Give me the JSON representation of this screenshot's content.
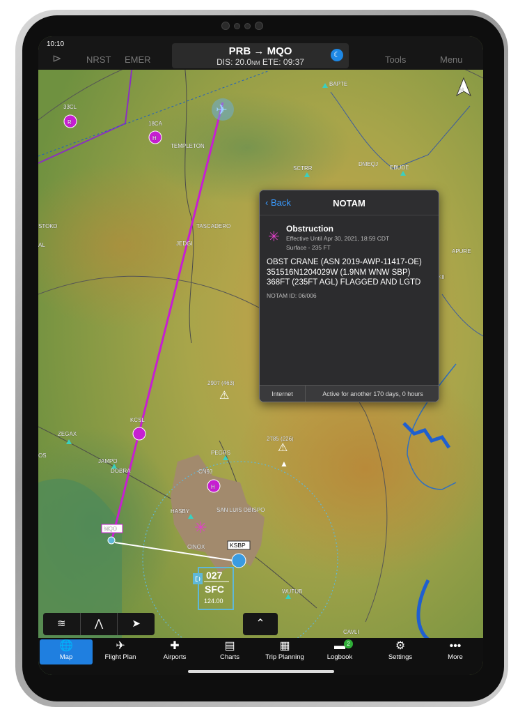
{
  "status_bar": {
    "time": "10:10"
  },
  "top_bar": {
    "direct_to": "⊳",
    "nrst": "NRST",
    "emer": "EMER",
    "route_title": "PRB → MQO",
    "route_sub_dis": "DIS: 20.0",
    "route_sub_unit": "NM",
    "route_sub_ete": "ETE: 09:37",
    "tools": "Tools",
    "menu": "Menu"
  },
  "map": {
    "north": "N",
    "waypoints": [
      "33CL",
      "18CA",
      "TEMPLETON",
      "BAPTE",
      "SCTRR",
      "DMEQJ",
      "EBUDE",
      "TASCADERO",
      "JEDGI",
      "STOKD",
      "AL",
      "APURE",
      "KII",
      "2907 (463)",
      "ZEGAX",
      "KCSL",
      "JAMPO",
      "DOBRA",
      "PEGRS",
      "CN93",
      "2785 (226)",
      "HASBY",
      "SAN LUIS OBISPO",
      "CINOX",
      "OS",
      "WUTUB",
      "CAVLI"
    ],
    "mqo_label": "MQO",
    "ksbp_label": "KSBP",
    "airspace": {
      "class": "D",
      "top": "027",
      "bottom": "SFC",
      "freq": "124.00"
    }
  },
  "notam": {
    "back": "Back",
    "title": "NOTAM",
    "type": "Obstruction",
    "effective": "Effective Until Apr 30, 2021, 18:59 CDT",
    "surface": "Surface - 235 FT",
    "text": "OBST CRANE (ASN 2019-AWP-11417-OE) 351516N1204029W (1.9NM WNW SBP) 368FT (235FT AGL) FLAGGED AND LGTD",
    "id": "NOTAM ID: 06/006",
    "source": "Internet",
    "active": "Active for another 170 days, 0 hours"
  },
  "tabs": [
    {
      "label": "Map",
      "icon": "globe-icon",
      "glyph": "🌐"
    },
    {
      "label": "Flight Plan",
      "icon": "flight-plan-icon",
      "glyph": "✈"
    },
    {
      "label": "Airports",
      "icon": "airport-icon",
      "glyph": "✚"
    },
    {
      "label": "Charts",
      "icon": "charts-icon",
      "glyph": "▤"
    },
    {
      "label": "Trip Planning",
      "icon": "trip-icon",
      "glyph": "▦"
    },
    {
      "label": "Logbook",
      "icon": "logbook-icon",
      "glyph": "▬",
      "badge": "2"
    },
    {
      "label": "Settings",
      "icon": "gear-icon",
      "glyph": "⚙"
    },
    {
      "label": "More",
      "icon": "more-icon",
      "glyph": "•••"
    }
  ],
  "colors": {
    "route": "#c61fd1",
    "accent": "#1f7fe0",
    "terrain_high": "#c8a04a",
    "terrain_low": "#5f8a40"
  }
}
